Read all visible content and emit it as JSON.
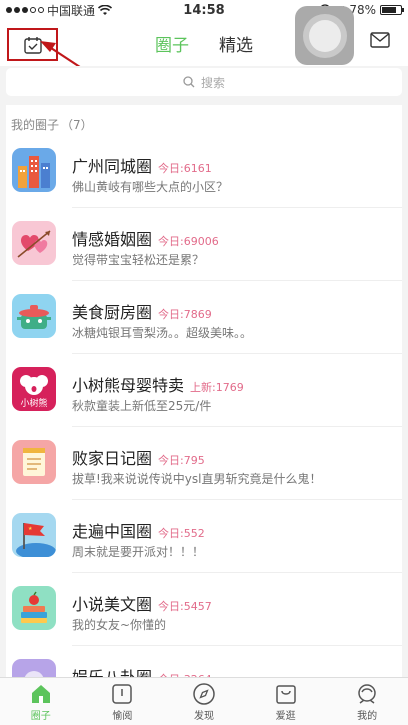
{
  "status_bar": {
    "carrier": "中国联通",
    "time": "14:58",
    "battery": "78%",
    "battery_level": 0.78
  },
  "header": {
    "tabs": [
      {
        "label": "圈子",
        "active": true
      },
      {
        "label": "精选",
        "active": false
      }
    ]
  },
  "search": {
    "placeholder": "搜索"
  },
  "my_circles": {
    "title": "我的圈子",
    "count": "（7）",
    "items": [
      {
        "name": "广州同城圈",
        "badge": "今日:6161",
        "desc": "佛山黄岐有哪些大点的小区？",
        "icon": "city-buildings-icon"
      },
      {
        "name": "情感婚姻圈",
        "badge": "今日:69006",
        "desc": "觉得带宝宝轻松还是累？",
        "icon": "hearts-arrow-icon"
      },
      {
        "name": "美食厨房圈",
        "badge": "今日:7869",
        "desc": "冰糖炖银耳雪梨汤。。超级美味。。",
        "icon": "cooking-pot-icon"
      },
      {
        "name": "小树熊母婴特卖",
        "badge": "上新:1769",
        "desc": "秋款童装上新低至25元/件",
        "icon": "koala-logo-icon",
        "logo_text": "小树熊"
      },
      {
        "name": "败家日记圈",
        "badge": "今日:795",
        "desc": "拔草!我来说说传说中ysl直男斩究竟是什么鬼！",
        "icon": "notepad-icon"
      },
      {
        "name": "走遍中国圈",
        "badge": "今日:552",
        "desc": "周末就是要开派对！！！",
        "icon": "flag-icon"
      },
      {
        "name": "小说美文圈",
        "badge": "今日:5457",
        "desc": "我的女友~你懂的",
        "icon": "books-apple-icon"
      },
      {
        "name": "娱乐八卦圈",
        "badge": "今日:3264",
        "desc": "",
        "icon": "entertainment-icon"
      }
    ]
  },
  "tab_bar": [
    {
      "label": "圈子",
      "icon": "home-icon",
      "active": true
    },
    {
      "label": "愉阅",
      "icon": "book-icon",
      "active": false
    },
    {
      "label": "发现",
      "icon": "compass-icon",
      "active": false
    },
    {
      "label": "爱逛",
      "icon": "shopping-bag-icon",
      "active": false
    },
    {
      "label": "我的",
      "icon": "profile-icon",
      "active": false
    }
  ],
  "colors": {
    "accent": "#5cc45c",
    "badge": "#e26b8a",
    "annotation": "#c0171a"
  }
}
